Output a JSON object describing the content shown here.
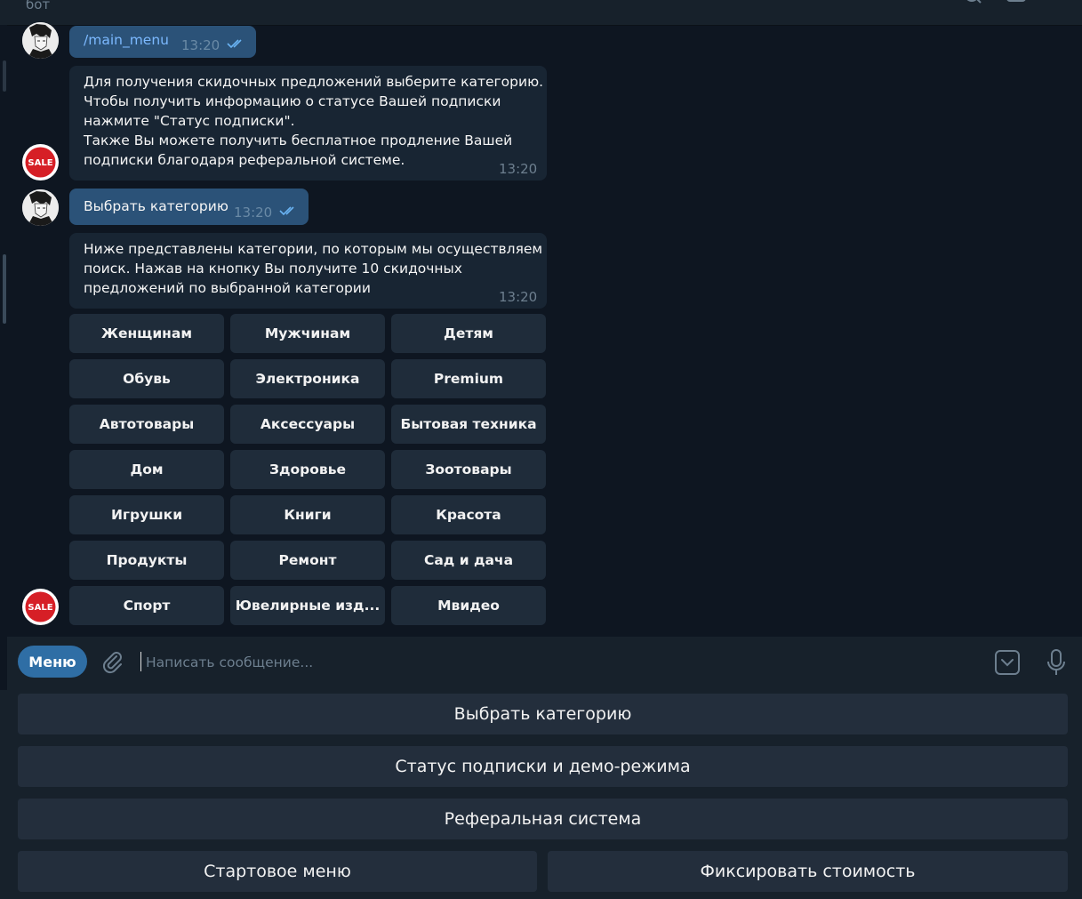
{
  "header": {
    "subtitle": "бот"
  },
  "messages": [
    {
      "text": "/main_menu",
      "time": "13:20"
    },
    {
      "text": "Для получения скидочных предложений выберите категорию.\nЧтобы получить информацию о статусе Вашей подписки\nнажмите \"Статус подписки\".\nТакже Вы можете получить бесплатное продление Вашей\nподписки благодаря реферальной системе.",
      "time": "13:20"
    },
    {
      "text": "Выбрать категорию",
      "time": "13:20"
    },
    {
      "text": "Ниже представлены категории, по которым мы осуществляем\nпоиск. Нажав на кнопку Вы получите 10 скидочных\nпредложений по выбранной категории",
      "time": "13:20"
    }
  ],
  "inline_keyboard": [
    "Женщинам",
    "Мужчинам",
    "Детям",
    "Обувь",
    "Электроника",
    "Premium",
    "Автотовары",
    "Аксессуары",
    "Бытовая техника",
    "Дом",
    "Здоровье",
    "Зоотовары",
    "Игрушки",
    "Книги",
    "Красота",
    "Продукты",
    "Ремонт",
    "Сад и дача",
    "Спорт",
    "Ювелирные изд...",
    "Мвидео"
  ],
  "avatars": {
    "bot_badge_text": "SALE"
  },
  "composer": {
    "menu_label": "Меню",
    "placeholder": "Написать сообщение..."
  },
  "reply_keyboard": {
    "choose_category": "Выбрать категорию",
    "subscription_status": "Статус подписки и демо-режима",
    "referral": "Реферальная система",
    "start_menu": "Стартовое меню",
    "fix_price": "Фиксировать стоимость"
  },
  "colors": {
    "background": "#0e1621",
    "outgoing": "#2b5278",
    "incoming": "#182533",
    "accent": "#2f6ea5"
  }
}
